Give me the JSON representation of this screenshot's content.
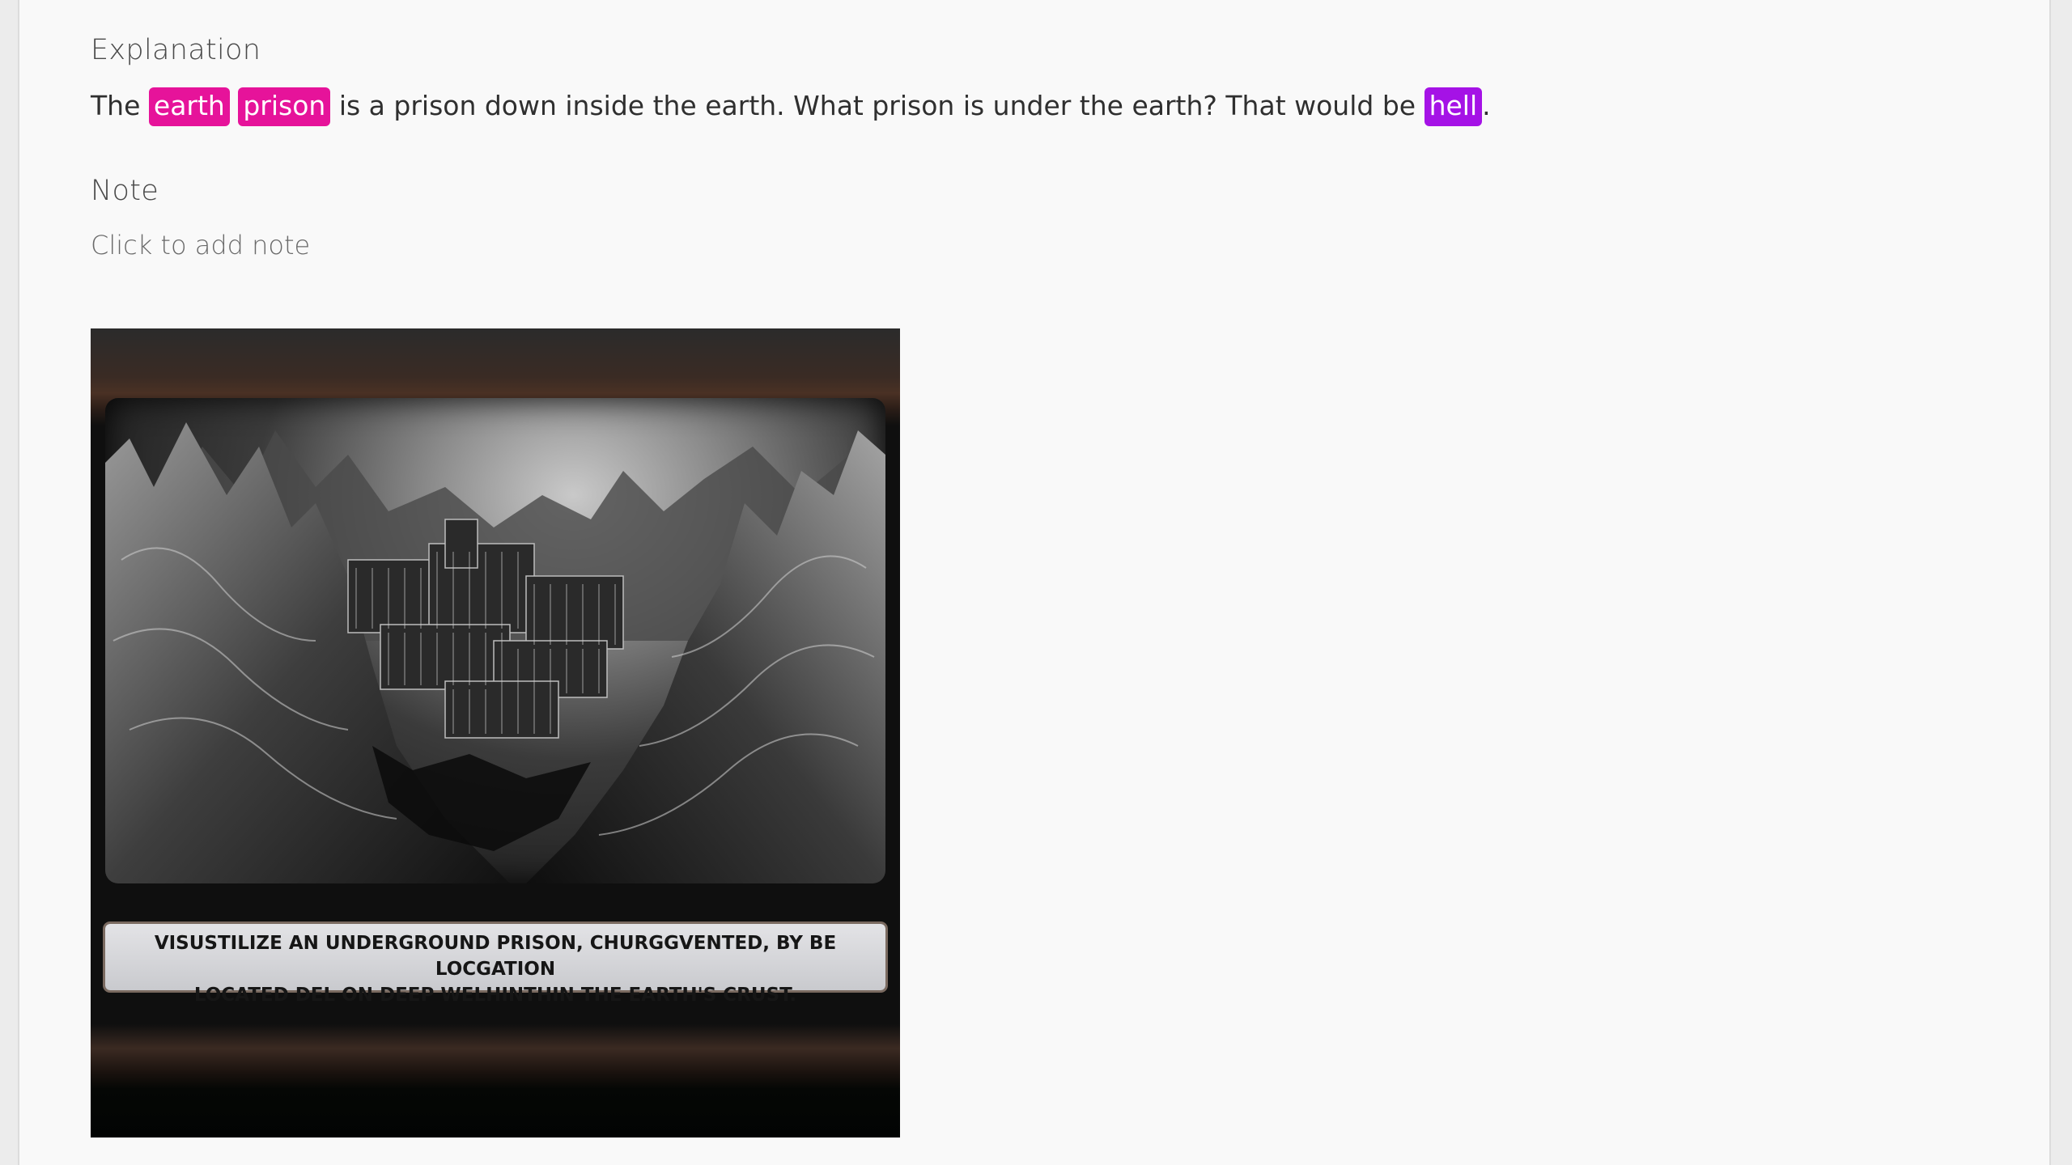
{
  "explanation": {
    "heading": "Explanation",
    "prefix": "The",
    "tags": [
      {
        "text": "earth",
        "color": "#e6139a"
      },
      {
        "text": "prison",
        "color": "#e6139a"
      },
      {
        "text": "hell",
        "color": "#a512e6"
      }
    ],
    "middle": "is a prison down inside the earth. What prison is under the earth? That would be",
    "suffix": "."
  },
  "note": {
    "heading": "Note",
    "placeholder": "Click to add note"
  },
  "image": {
    "caption": "VISUSTILIZE AN UNDERGROUND PRISON, CHURGGVENTED, BY BE LOCGATION\nLOCATED DEL ON DEEP WELHINTHIN THE EARTH'S CRUST."
  }
}
